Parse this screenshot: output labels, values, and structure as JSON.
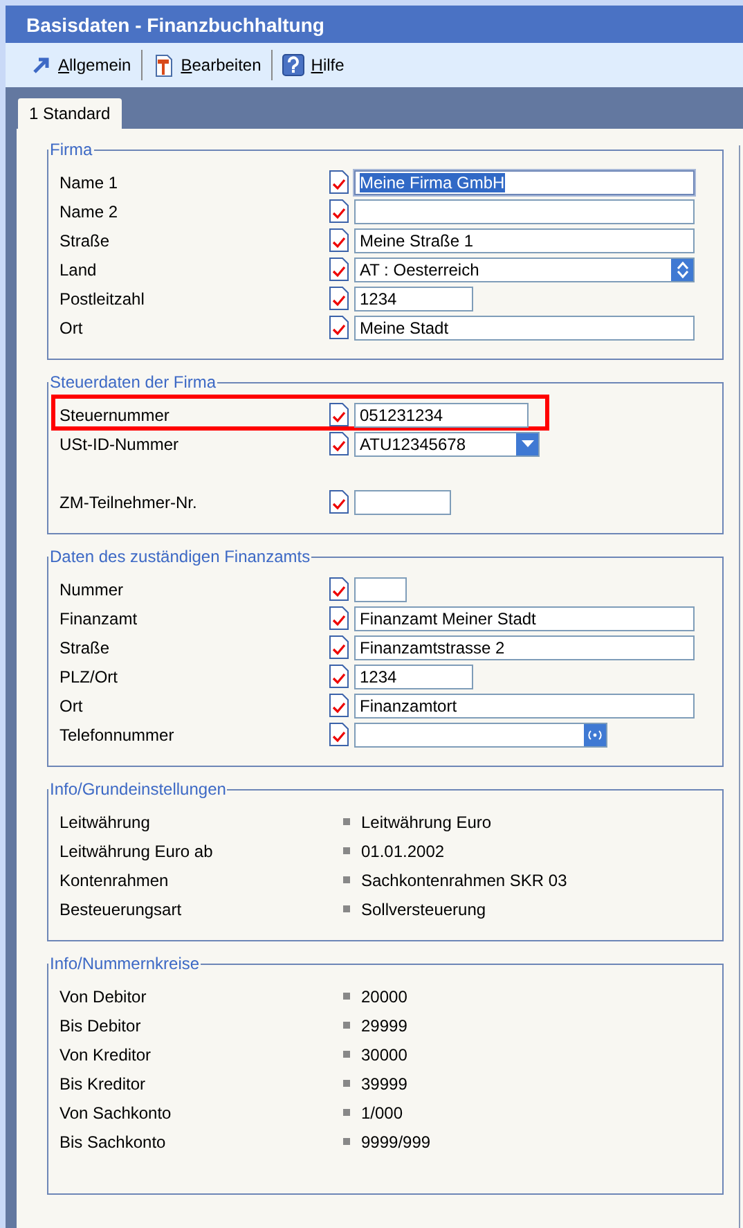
{
  "window": {
    "title": "Basisdaten - Finanzbuchhaltung"
  },
  "toolbar": [
    {
      "label": "Allgemein"
    },
    {
      "label": "Bearbeiten"
    },
    {
      "label": "Hilfe"
    }
  ],
  "tabs": [
    {
      "label": "1 Standard",
      "selected": true
    }
  ],
  "groups": [
    {
      "title": "Firma",
      "kind": "form",
      "rows": [
        {
          "label": "Name 1",
          "kind": "text",
          "value": "Meine Firma GmbH",
          "selected": true,
          "highlighted": false
        },
        {
          "label": "Name 2",
          "kind": "text",
          "selected": false,
          "highlighted": false
        },
        {
          "label": "Straße",
          "kind": "text",
          "value": "Meine Straße 1",
          "selected": false,
          "highlighted": false
        },
        {
          "label": "Land",
          "kind": "spin",
          "value": "AT   : Oesterreich",
          "selected": false,
          "highlighted": false
        },
        {
          "label": "Postleitzahl",
          "kind": "text",
          "value": "1234",
          "selected": false,
          "highlighted": false
        },
        {
          "label": "Ort",
          "kind": "text",
          "value": "Meine Stadt",
          "selected": false,
          "highlighted": false
        }
      ]
    },
    {
      "title": "Steuerdaten der Firma",
      "kind": "form",
      "rows": [
        {
          "label": "Steuernummer",
          "kind": "text",
          "value": "051231234",
          "selected": false,
          "highlighted": true
        },
        {
          "label": "USt-ID-Nummer",
          "kind": "dropdown",
          "value": "ATU12345678",
          "selected": false,
          "highlighted": false
        },
        {
          "label": "ZM-Teilnehmer-Nr.",
          "kind": "text",
          "selected": false,
          "highlighted": false
        }
      ]
    },
    {
      "title": "Daten des zuständigen Finanzamts",
      "kind": "form",
      "rows": [
        {
          "label": "Nummer",
          "kind": "text",
          "selected": false,
          "highlighted": false
        },
        {
          "label": "Finanzamt",
          "kind": "text",
          "value": "Finanzamt Meiner Stadt",
          "selected": false,
          "highlighted": false
        },
        {
          "label": "Straße",
          "kind": "text",
          "value": "Finanzamtstrasse 2",
          "selected": false,
          "highlighted": false
        },
        {
          "label": "PLZ/Ort",
          "kind": "text",
          "value": "1234",
          "selected": false,
          "highlighted": false
        },
        {
          "label": "Ort",
          "kind": "text",
          "value": "Finanzamtort",
          "selected": false,
          "highlighted": false
        },
        {
          "label": "Telefonnummer",
          "kind": "button",
          "selected": false,
          "highlighted": false
        }
      ]
    },
    {
      "title": "Info/Grundeinstellungen",
      "kind": "info",
      "rows": [
        {
          "label": "Leitwährung",
          "value": "Leitwährung Euro"
        },
        {
          "label": "Leitwährung Euro ab",
          "value": "01.01.2002"
        },
        {
          "label": "Kontenrahmen",
          "value": "Sachkontenrahmen SKR 03"
        },
        {
          "label": "Besteuerungsart",
          "value": "Sollversteuerung"
        }
      ]
    },
    {
      "title": "Info/Nummernkreise",
      "kind": "info",
      "rows": [
        {
          "label": "Von Debitor",
          "value": "20000"
        },
        {
          "label": "Bis Debitor",
          "value": "29999"
        },
        {
          "label": "Von Kreditor",
          "value": "30000"
        },
        {
          "label": "Bis Kreditor",
          "value": "39999"
        },
        {
          "label": "Von Sachkonto",
          "value": "1/000"
        },
        {
          "label": "Bis Sachkonto",
          "value": "9999/999"
        }
      ]
    }
  ]
}
